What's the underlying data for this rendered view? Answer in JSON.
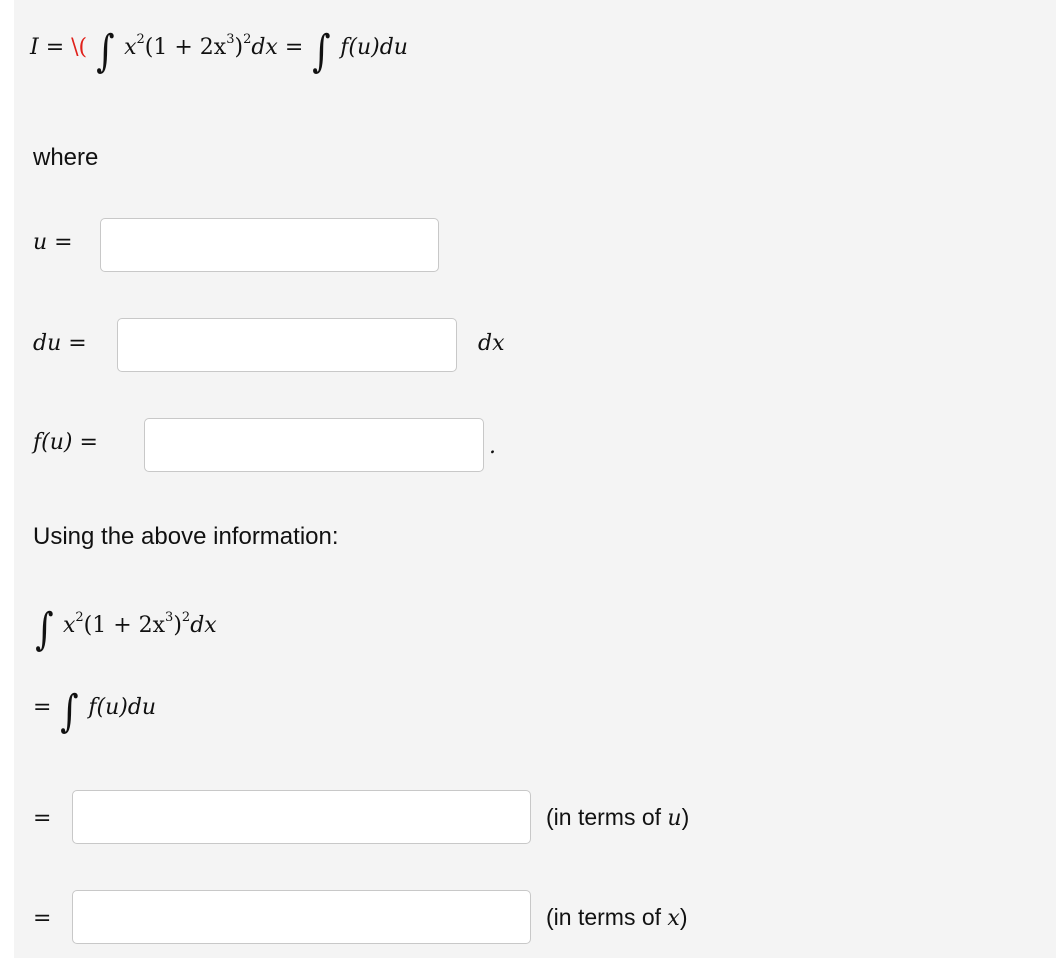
{
  "header": {
    "lhs": "I",
    "eq": "=",
    "stray": "\\(",
    "integrand_base": "x",
    "integrand_rest": "(1 + 2x",
    "close_paren": ")",
    "dx": "dx",
    "rhs_fu": "f(u)du",
    "exp2": "2",
    "exp3": "3"
  },
  "where_label": "where",
  "u_label": "u =",
  "du_label": "du =",
  "du_suffix": "dx",
  "fu_label": "f(u) =",
  "fu_suffix": ".",
  "using_label": "Using the above information:",
  "eq_sign": "=",
  "in_terms_u_prefix": "(in terms of ",
  "in_terms_u_var": "u",
  "in_terms_x_prefix": "(in terms of ",
  "in_terms_x_var": "x",
  "close": ")",
  "integral_symbol": "∫",
  "colors": {
    "background": "#f4f4f4",
    "input_border": "#c8c8c8",
    "red_text": "#e0201a"
  }
}
